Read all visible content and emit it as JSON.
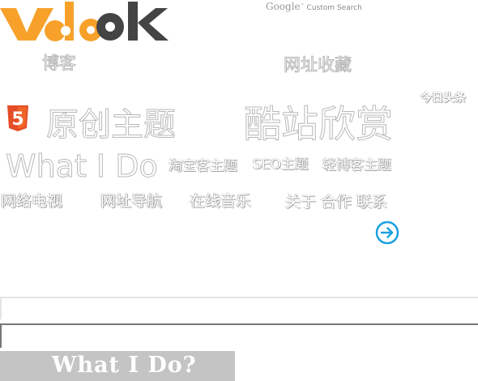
{
  "header": {
    "logo_text": "vdoook",
    "search_brand": "Google",
    "search_label": "Custom Search"
  },
  "tiles": {
    "blog": "博客",
    "favorites": "网址收藏",
    "toutiao": "今日头条",
    "html5_badge": "5",
    "original_themes": "原创主题",
    "cool_sites": "酷站欣赏",
    "what_i_do": "What I Do",
    "taobao_themes": "淘宝客主题",
    "seo_themes": "SEO主题",
    "light_blog_themes": "轻博客主题",
    "web_tv": "网络电视",
    "url_nav": "网址导航",
    "online_music": "在线音乐",
    "about_contact": "关于 合作 联系"
  },
  "footer": {
    "banner_text": "What I Do?"
  },
  "colors": {
    "logo_orange": "#f7a12b",
    "logo_dark": "#444444",
    "html5_orange": "#e44d26",
    "arrow_blue": "#1ba1e2",
    "banner_gray": "#c4c4c4"
  }
}
